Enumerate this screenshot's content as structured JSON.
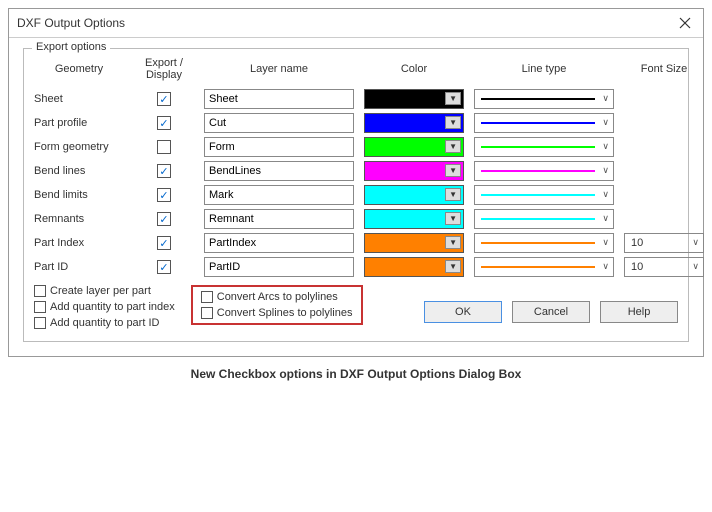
{
  "dialog": {
    "title": "DXF Output Options",
    "fieldset_legend": "Export options"
  },
  "headers": {
    "geometry": "Geometry",
    "export_display": "Export / Display",
    "layer_name": "Layer name",
    "color": "Color",
    "line_type": "Line type",
    "font_size": "Font Size"
  },
  "rows": [
    {
      "label": "Sheet",
      "checked": true,
      "layer": "Sheet",
      "color": "#000000",
      "line": "#000000",
      "fontsize": ""
    },
    {
      "label": "Part profile",
      "checked": true,
      "layer": "Cut",
      "color": "#0000ff",
      "line": "#0000ff",
      "fontsize": ""
    },
    {
      "label": "Form geometry",
      "checked": false,
      "layer": "Form",
      "color": "#00ff00",
      "line": "#00ff00",
      "fontsize": ""
    },
    {
      "label": "Bend lines",
      "checked": true,
      "layer": "BendLines",
      "color": "#ff00ff",
      "line": "#ff00ff",
      "fontsize": ""
    },
    {
      "label": "Bend limits",
      "checked": true,
      "layer": "Mark",
      "color": "#00ffff",
      "line": "#00ffff",
      "fontsize": ""
    },
    {
      "label": "Remnants",
      "checked": true,
      "layer": "Remnant",
      "color": "#00ffff",
      "line": "#00ffff",
      "fontsize": ""
    },
    {
      "label": "Part Index",
      "checked": true,
      "layer": "PartIndex",
      "color": "#ff8000",
      "line": "#ff8000",
      "fontsize": "10"
    },
    {
      "label": "Part ID",
      "checked": true,
      "layer": "PartID",
      "color": "#ff8000",
      "line": "#ff8000",
      "fontsize": "10"
    }
  ],
  "options": {
    "create_layer_per_part": "Create layer per part",
    "add_qty_to_index": "Add quantity to part index",
    "add_qty_to_id": "Add quantity to part ID",
    "convert_arcs": "Convert Arcs to polylines",
    "convert_splines": "Convert Splines to polylines"
  },
  "buttons": {
    "ok": "OK",
    "cancel": "Cancel",
    "help": "Help"
  },
  "caption": "New Checkbox options in DXF Output Options Dialog Box"
}
